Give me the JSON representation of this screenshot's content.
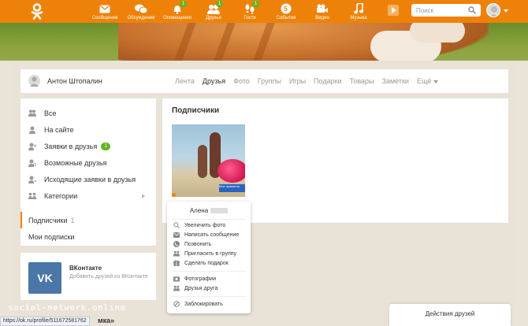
{
  "topbar": {
    "nav": [
      {
        "label": "Сообщения",
        "icon": "envelope-icon",
        "badge": ""
      },
      {
        "label": "Обсуждения",
        "icon": "chat-bubbles-icon",
        "badge": ""
      },
      {
        "label": "Оповещения",
        "icon": "bell-icon",
        "badge": "1"
      },
      {
        "label": "Друзья",
        "icon": "friends-icon",
        "badge": "1"
      },
      {
        "label": "Гости",
        "icon": "footprints-icon",
        "badge": "1"
      },
      {
        "label": "События",
        "icon": "events-icon",
        "badge": ""
      },
      {
        "label": "Видео",
        "icon": "video-camera-icon",
        "badge": ""
      },
      {
        "label": "Музыка",
        "icon": "music-note-icon",
        "badge": ""
      }
    ],
    "search_placeholder": "Поиск"
  },
  "profile": {
    "name": "Антон Штопалин",
    "tabs": [
      "Лента",
      "Друзья",
      "Фото",
      "Группы",
      "Игры",
      "Подарки",
      "Товары",
      "Заметки"
    ],
    "active_tab": "Друзья",
    "more_tab": "Ещё"
  },
  "sidebar": {
    "items": [
      {
        "label": "Все",
        "icon": "people-icon"
      },
      {
        "label": "На сайте",
        "icon": "person-online-icon"
      },
      {
        "label": "Заявки в друзья",
        "icon": "person-request-icon",
        "badge": "1"
      },
      {
        "label": "Возможные друзья",
        "icon": "person-search-icon"
      },
      {
        "label": "Исходящие заявки в друзья",
        "icon": "person-outgoing-icon"
      },
      {
        "label": "Категории",
        "icon": "categories-icon"
      }
    ],
    "subscribers_label": "Подписчики",
    "subscribers_count": "1",
    "my_subscriptions": "Мои подписки"
  },
  "vk": {
    "logo": "VK",
    "title": "ВКонтакте",
    "subtitle": "Добавить друзей из ВКонтакте"
  },
  "main": {
    "title": "Подписчики",
    "photo_sign": "Мне нравится"
  },
  "popup": {
    "name": "Алена",
    "items_group1": [
      {
        "label": "Увеличить фото",
        "icon": "zoom-icon"
      },
      {
        "label": "Написать сообщение",
        "icon": "message-icon"
      },
      {
        "label": "Позвонить",
        "icon": "phone-icon"
      },
      {
        "label": "Пригласить в группу",
        "icon": "group-invite-icon"
      },
      {
        "label": "Сделать подарок",
        "icon": "gift-icon"
      }
    ],
    "items_group2": [
      {
        "label": "Фотографии",
        "icon": "photos-icon"
      },
      {
        "label": "Друзья друга",
        "icon": "friends-of-friend-icon"
      }
    ],
    "block_label": "Заблокировать"
  },
  "friends_actions": "Действия друзей",
  "status_url": "https://ok.ru/profile/511672581762",
  "watermark": "social-network.online",
  "under_text": "мка»"
}
